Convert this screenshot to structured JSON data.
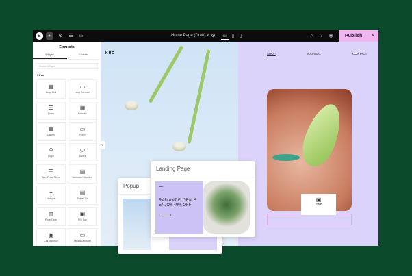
{
  "toolbar": {
    "page_title": "Home Page (Draft) ˅",
    "publish": "Publish",
    "publish_chevron": "˅"
  },
  "sidebar": {
    "title": "Elements",
    "tabs": [
      "Widgets",
      "Globals"
    ],
    "search_placeholder": "Search Widget",
    "section": "▾ Pro",
    "widgets": [
      "Loop Grid",
      "Loop Carousel",
      "Posts",
      "Portfolio",
      "Gallery",
      "Form",
      "Login",
      "Slides",
      "WordPress Menu",
      "Animated Headline",
      "Hotspot",
      "Price List",
      "Price Table",
      "Flip Box",
      "Call to Action",
      "Media Carousel"
    ]
  },
  "site": {
    "logo": "KHC",
    "nav": [
      "SHOP",
      "JOURNAL",
      "CONTACT"
    ]
  },
  "landing": {
    "title": "Landing Page",
    "brand": "KHC",
    "headline": "RADIANT FLORALS ENJOY 40% OFF"
  },
  "popup": {
    "title": "Popup"
  },
  "image_widget": {
    "label": "Image"
  }
}
